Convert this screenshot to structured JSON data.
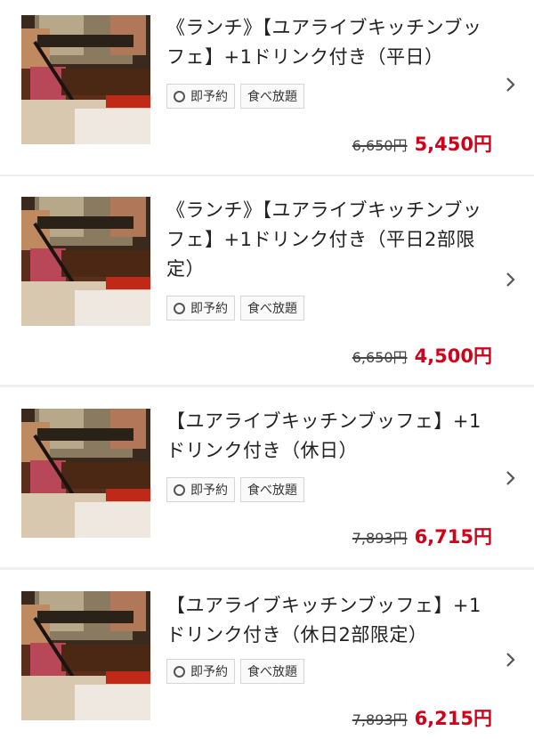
{
  "plans": [
    {
      "title": "《ランチ》【ユアライブキッチンブッフェ】+1ドリンク付き（平日）",
      "tags": {
        "instant": "即予約",
        "buffet": "食べ放題"
      },
      "price_old": "6,650円",
      "price_new": "5,450円"
    },
    {
      "title": "《ランチ》【ユアライブキッチンブッフェ】+1ドリンク付き（平日2部限定）",
      "tags": {
        "instant": "即予約",
        "buffet": "食べ放題"
      },
      "price_old": "6,650円",
      "price_new": "4,500円"
    },
    {
      "title": "【ユアライブキッチンブッフェ】+1ドリンク付き（休日）",
      "tags": {
        "instant": "即予約",
        "buffet": "食べ放題"
      },
      "price_old": "7,893円",
      "price_new": "6,715円"
    },
    {
      "title": "【ユアライブキッチンブッフェ】+1ドリンク付き（休日2部限定）",
      "tags": {
        "instant": "即予約",
        "buffet": "食べ放題"
      },
      "price_old": "7,893円",
      "price_new": "6,215円"
    }
  ],
  "colors": {
    "price_accent": "#d0021b",
    "background": "#efefef",
    "card": "#ffffff"
  },
  "icons": {
    "tag_instant": "ring-icon",
    "row_action": "chevron-right-icon",
    "thumbnail": "roast-beef-carving-photo"
  }
}
